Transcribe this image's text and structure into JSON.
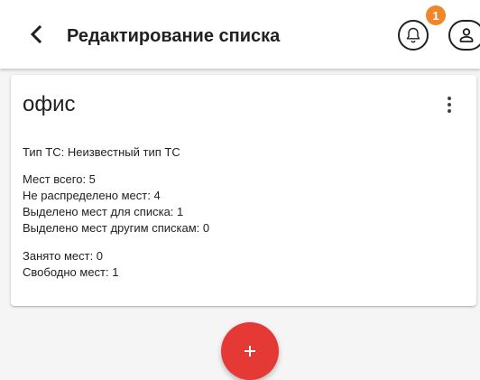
{
  "header": {
    "title": "Редактирование списка",
    "back_icon": "chevron-left-icon",
    "notification_icon": "bell-icon",
    "notification_count": "1",
    "user_icon": "user-icon"
  },
  "card": {
    "title": "офис",
    "menu_icon": "more-vertical-icon",
    "vehicle_type": "Тип ТС: Неизвестный тип ТС",
    "seats_total": "Мест всего: 5",
    "seats_unassigned": "Не распределено мест: 4",
    "seats_for_list": "Выделено мест для списка: 1",
    "seats_other_lists": "Выделено мест другим спискам: 0",
    "seats_occupied": "Занято мест: 0",
    "seats_free": "Свободно мест: 1"
  },
  "fab": {
    "label": "+",
    "icon": "plus-icon"
  },
  "colors": {
    "fab": "#e53935",
    "badge": "#f0862a",
    "background": "#f5f5f5"
  }
}
